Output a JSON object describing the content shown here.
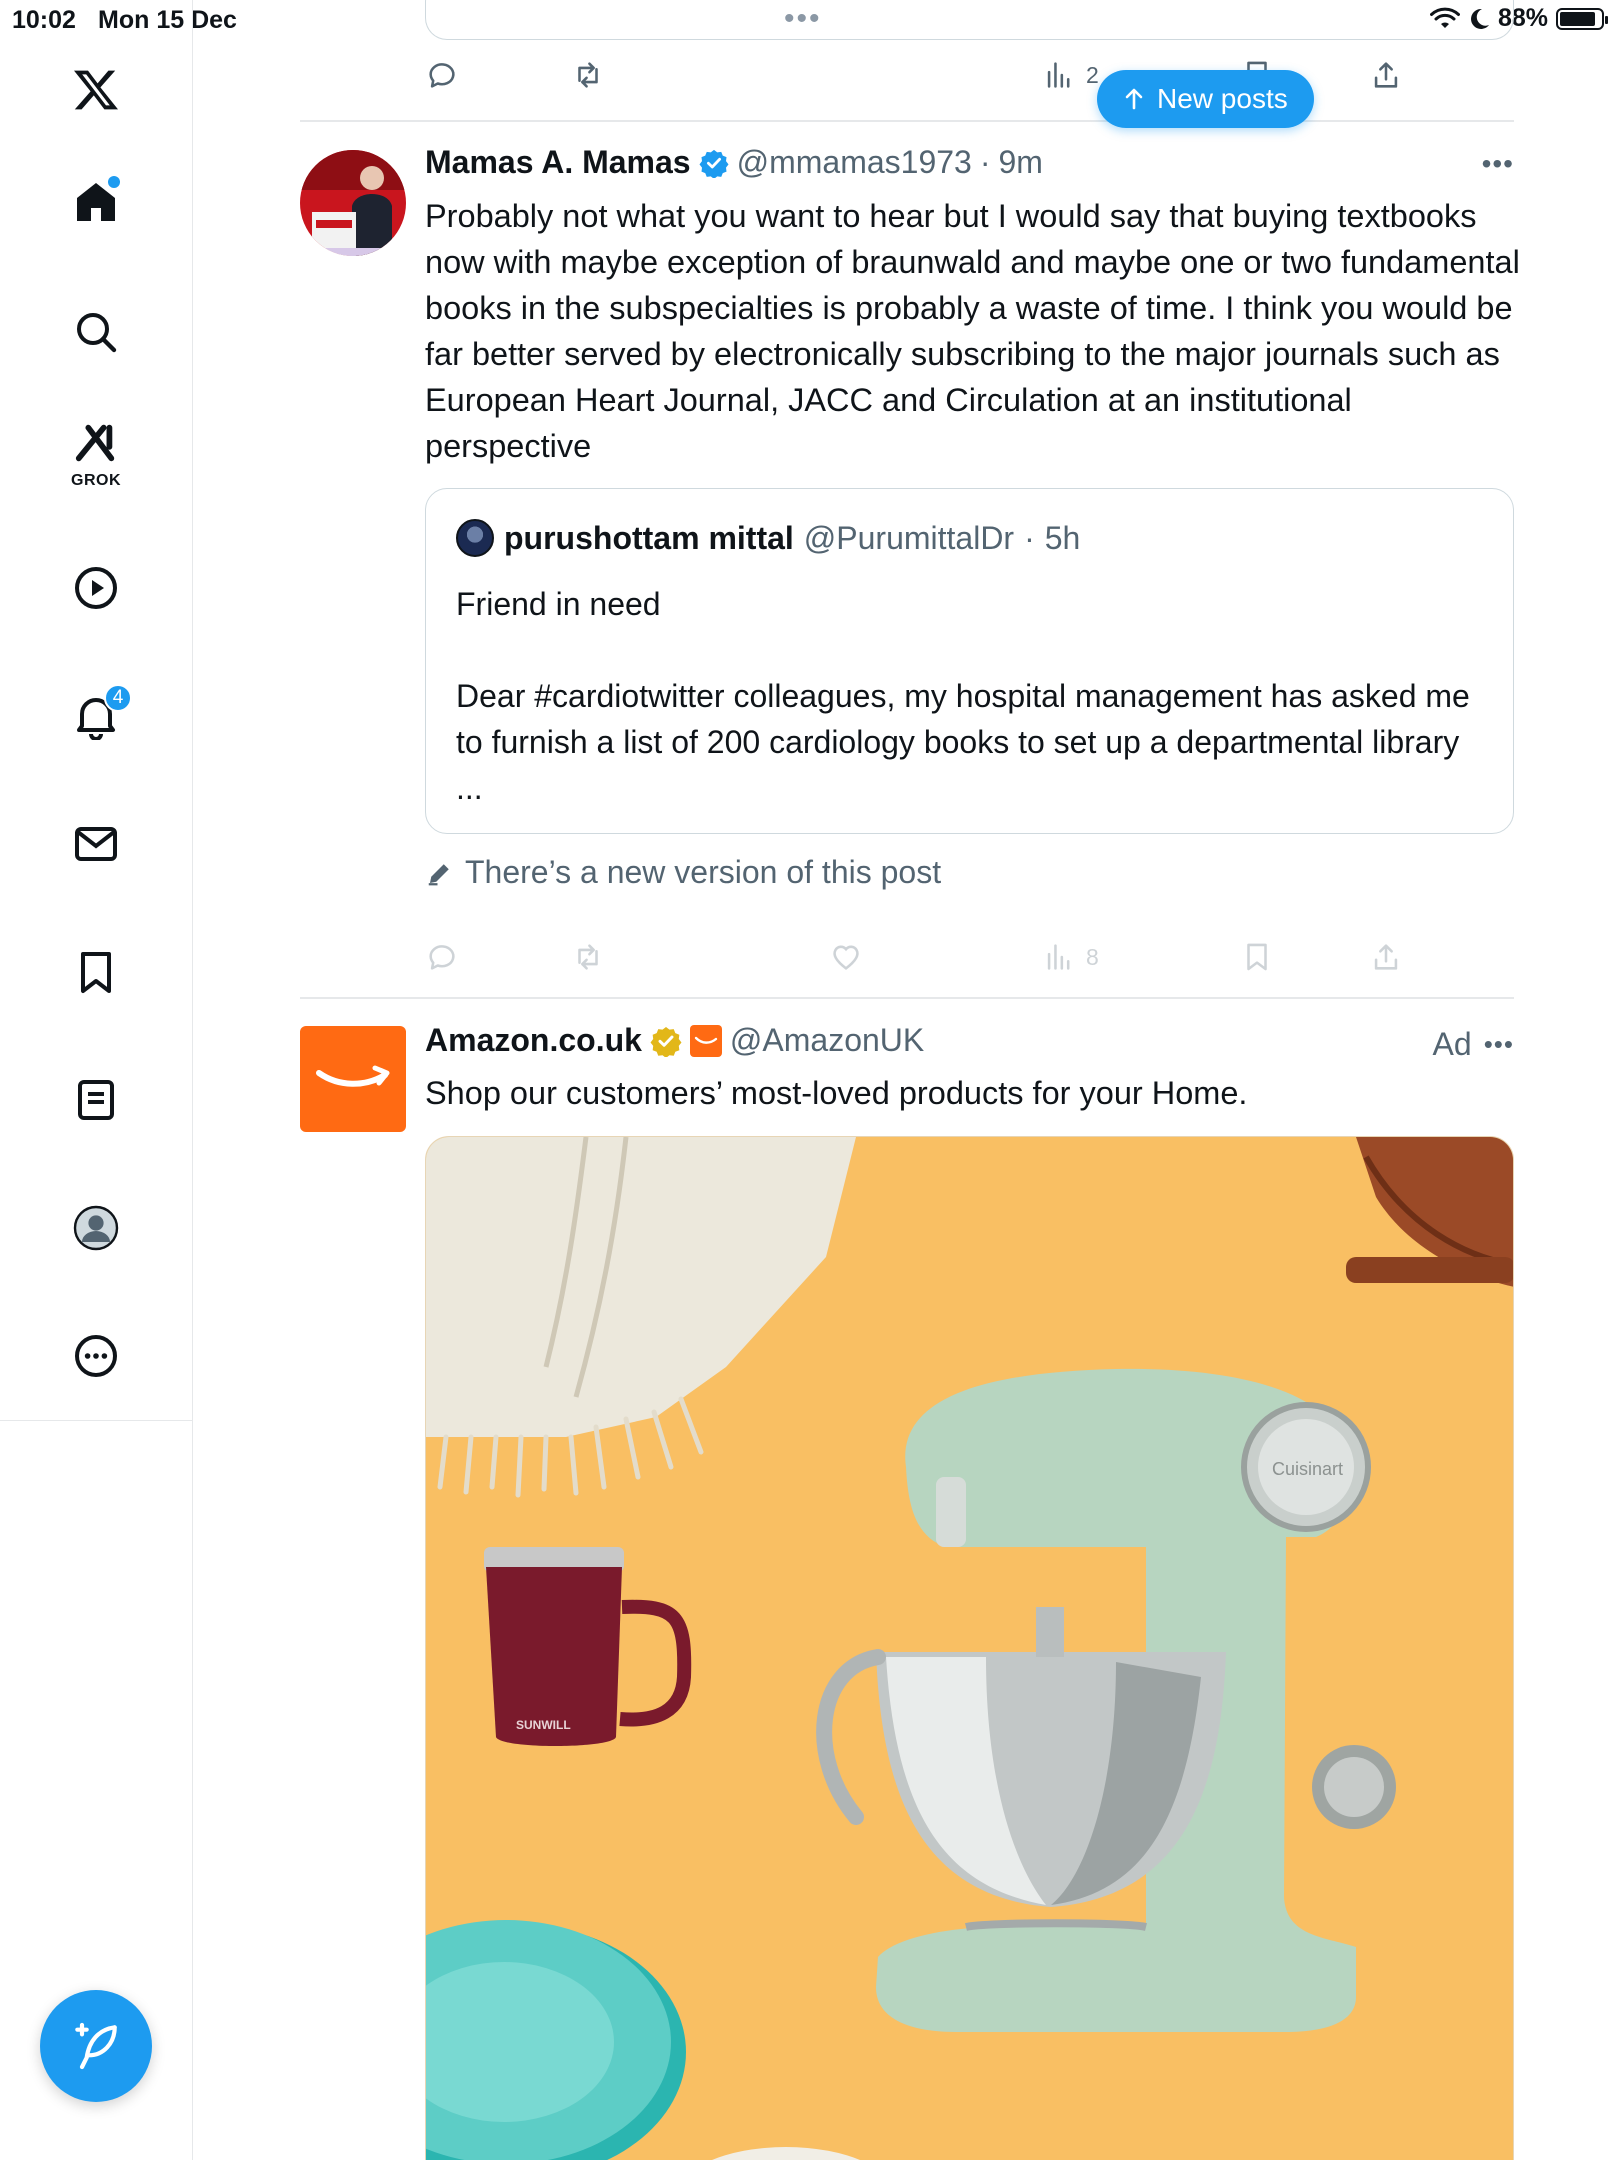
{
  "status_bar": {
    "time": "10:02",
    "date": "Mon 15 Dec",
    "battery": "88%",
    "battery_level": 0.88
  },
  "sidebar": {
    "home_has_new": true,
    "grok_label": "GROK",
    "notifications_count": "4"
  },
  "new_posts_button": "New posts",
  "prev_post_actions": {
    "views": "2"
  },
  "post": {
    "author_name": "Mamas A. Mamas",
    "handle": "@mmamas1973",
    "time": "9m",
    "text": "Probably not what you want to hear but I would say that buying textbooks now with maybe exception of braunwald and maybe one or two fundamental books in the subspecialties is probably a waste of time. I think you would be far better served by electronically subscribing to the major journals such as European Heart Journal, JACC and Circulation at an institutional perspective",
    "quote": {
      "author_name": "purushottam mittal",
      "handle": "@PurumittalDr",
      "time": "5h",
      "line1": "Friend in need",
      "line2": "Dear #cardiotwitter colleagues, my hospital management has asked me to furnish a list of 200 cardiology books to set up a departmental library ..."
    },
    "edit_notice": "There’s a new version of this post",
    "views": "8"
  },
  "ad": {
    "author_name": "Amazon.co.uk",
    "handle": "@AmazonUK",
    "ad_label": "Ad",
    "text": "Shop our customers’ most-loved products for your Home.",
    "mug_brand": "SUNWILL",
    "mixer_brand": "Cuisinart"
  },
  "colors": {
    "accent": "#1d9bf0",
    "secondary_text": "#536471",
    "amazon_orange": "#ff6a13",
    "ad_background": "#f9bf63"
  }
}
